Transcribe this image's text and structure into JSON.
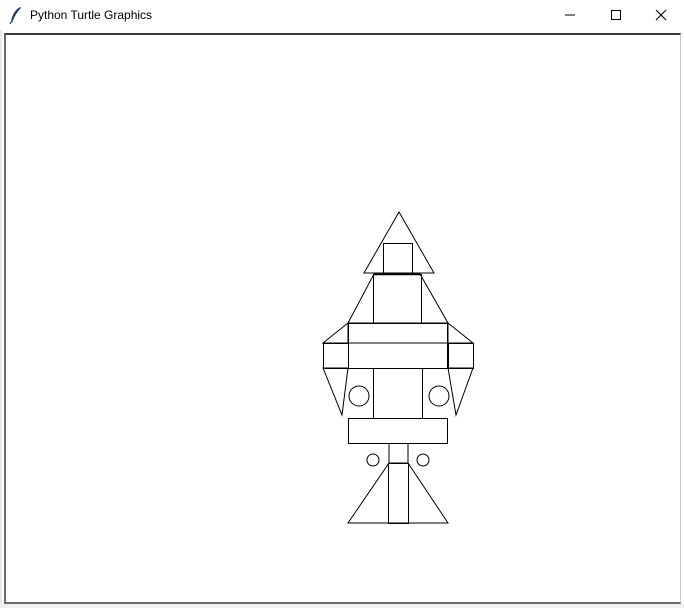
{
  "window": {
    "title": "Python Turtle Graphics",
    "icon": "feather-icon",
    "controls": {
      "minimize": "minimize-icon",
      "maximize": "maximize-icon",
      "close": "close-icon"
    }
  },
  "canvas": {
    "background": "#ffffff",
    "stroke_color": "#000000",
    "drawing": "rocket-shape"
  }
}
